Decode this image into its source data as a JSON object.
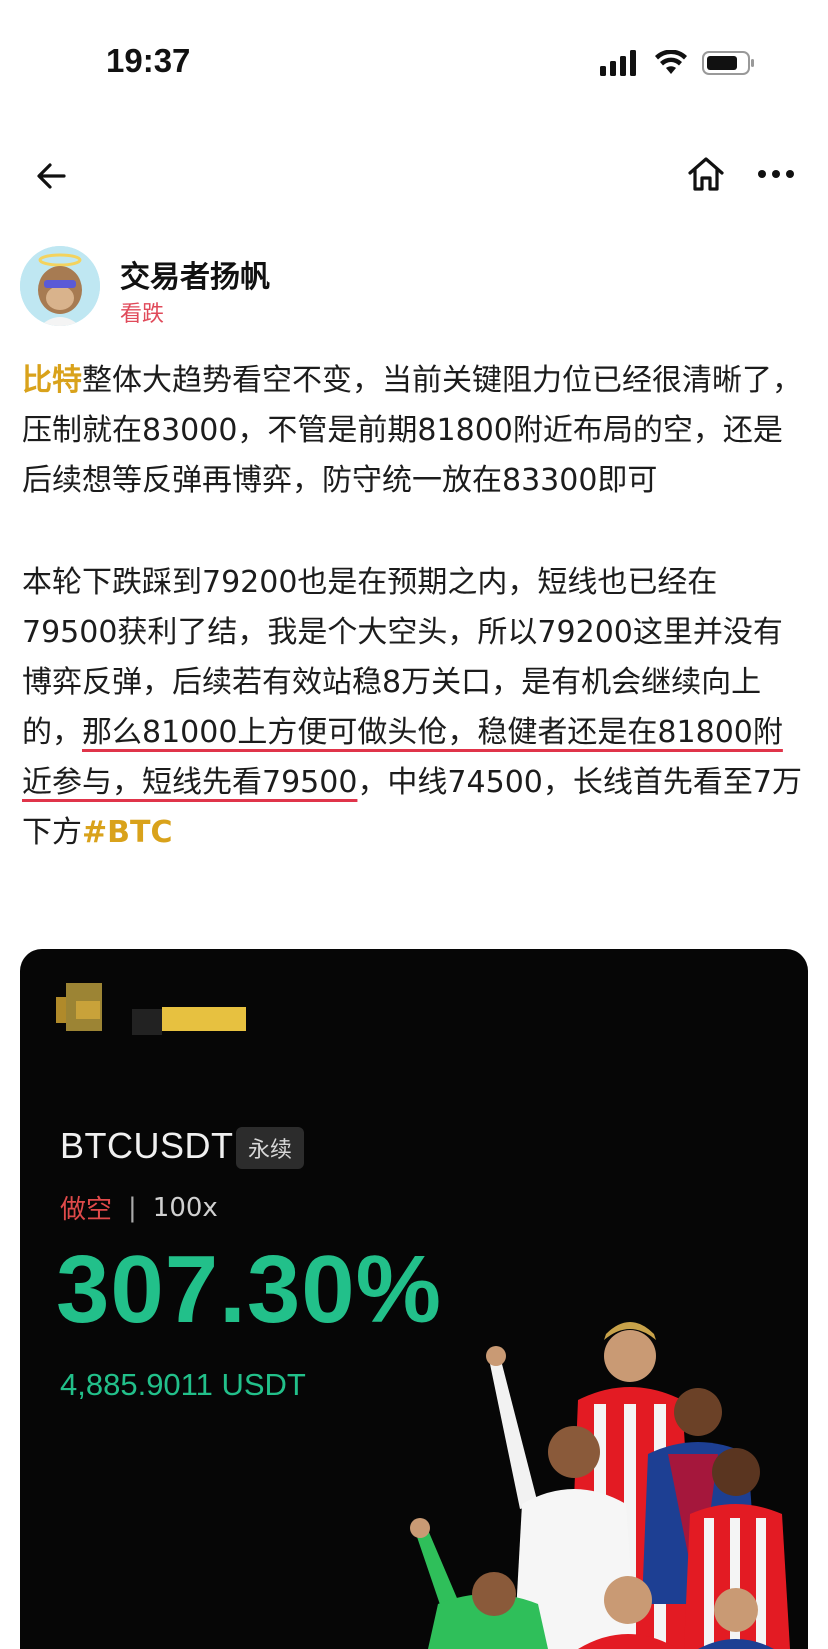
{
  "status_bar": {
    "time": "19:37"
  },
  "author": {
    "name": "交易者扬帆",
    "tag": "看跌"
  },
  "post": {
    "p1_highlight": "比特",
    "p1_rest": "整体大趋势看空不变，当前关键阻力位已经很清晰了，压制就在83000，不管是前期81800附近布局的空，还是后续想等反弹再博弈，防守统一放在83300即可",
    "p2_a": "本轮下跌踩到79200也是在预期之内，短线也已经在79500获利了结，我是个大空头，所以79200这里并没有博弈反弹，后续若有效站稳8万关口，是有机会继续向上的，",
    "p2_underlined": "那么81000上方便可做头伧，稳健者还是在81800附近参与，短线先看79500",
    "p2_b": "，中线74500，长线首先看至7万下方",
    "hashtag": "#BTC"
  },
  "card": {
    "pair": "BTCUSDT",
    "perp_badge": "永续",
    "side": "做空",
    "leverage": "100x",
    "roi": "307.30%",
    "pnl": "4,885.9011 USDT"
  },
  "colors": {
    "gold": "#d9a21b",
    "green": "#22c08a",
    "red": "#e04a4a",
    "underline": "#e0344a"
  },
  "icons": [
    "back-arrow-icon",
    "home-icon",
    "more-icon",
    "signal-icon",
    "wifi-icon",
    "battery-icon"
  ]
}
